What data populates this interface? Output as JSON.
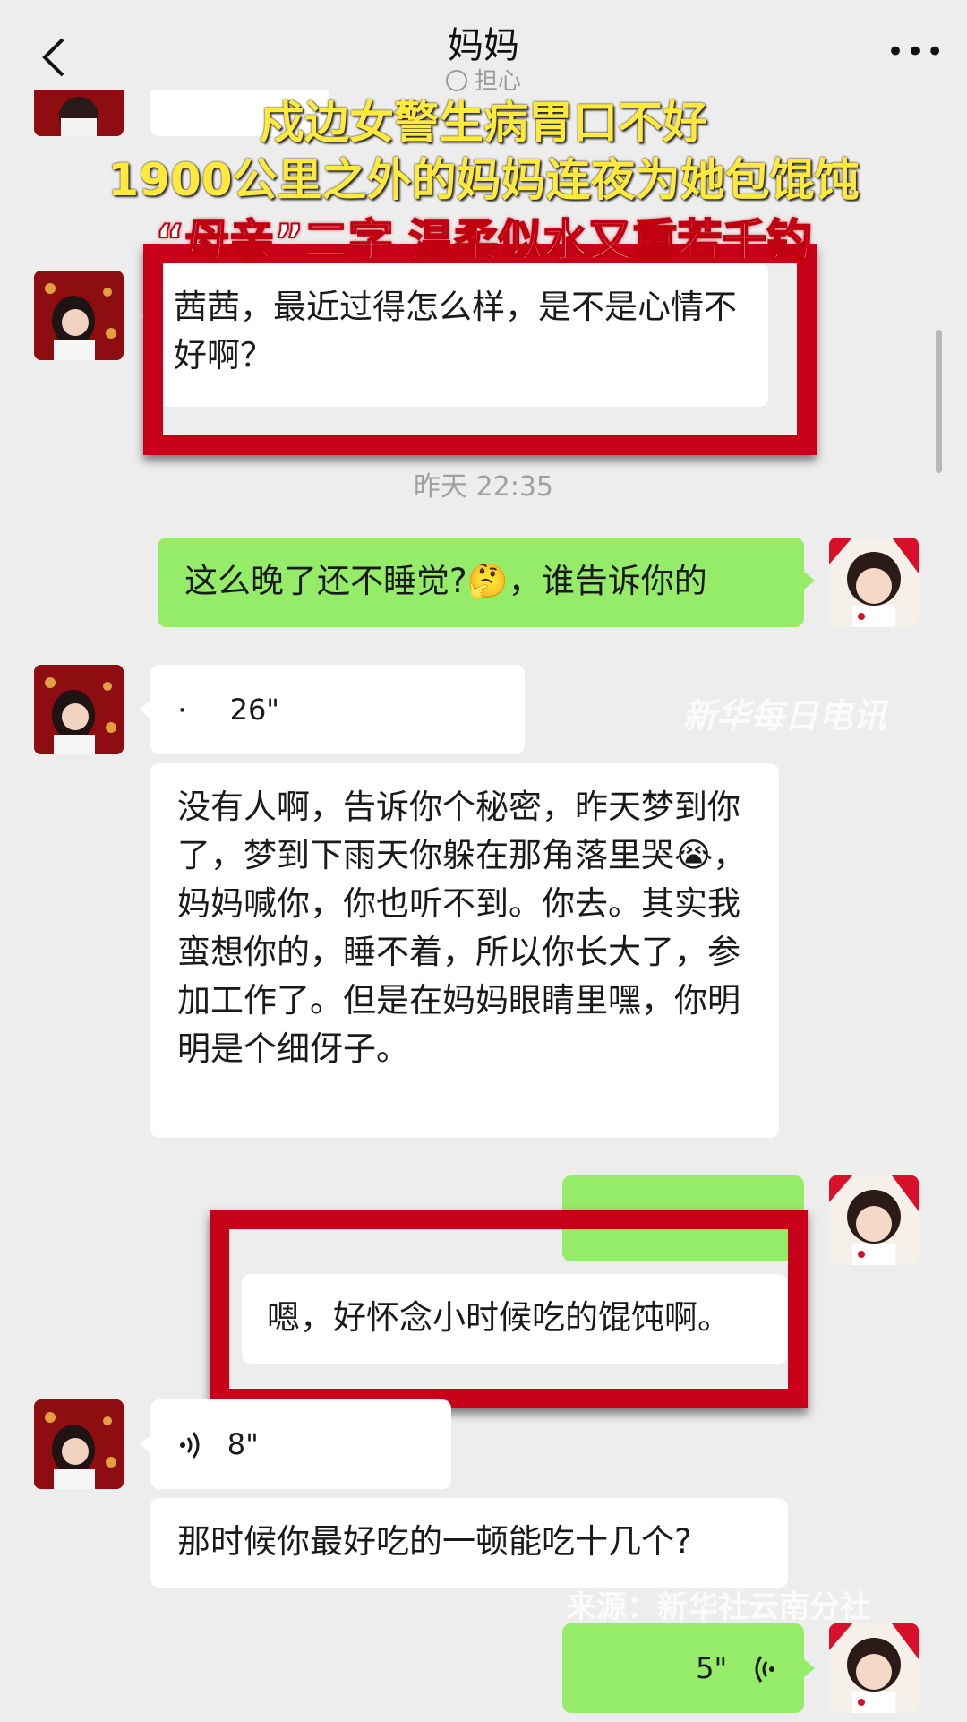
{
  "header": {
    "title": "妈妈",
    "status": "担心",
    "back_icon": "chevron-left-icon",
    "more_icon": "more-icon",
    "more_glyph": "•••"
  },
  "overlay": {
    "line1": "戍边女警生病胃口不好",
    "line2": "1900公里之外的妈妈连夜为她包馄饨",
    "line3": "“母亲”二字 温柔似水又重若千钧"
  },
  "messages": {
    "m1": "茜茜，最近过得怎么样，是不是心情不好啊？",
    "timestamp": "昨天 22:35",
    "m2": "这么晚了还不睡觉?🤔，谁告诉你的",
    "voice1_duration": "26\"",
    "m3": "没有人啊，告诉你个秘密，昨天梦到你了，梦到下雨天你躲在那角落里哭😭，妈妈喊你，你也听不到。你去。其实我蛮想你的，睡不着，所以你长大了，参加工作了。但是在妈妈眼睛里嘿，你明明是个细伢子。",
    "m4": "嗯，好怀念小时候吃的馄饨啊。",
    "voice2_duration": "8\"",
    "m5": "那时候你最好吃的一顿能吃十几个?",
    "voice3_duration": "5\""
  },
  "watermarks": {
    "logo": "新华每日电讯",
    "source": "来源：新华社云南分社"
  },
  "colors": {
    "background": "#ededed",
    "sent_bubble": "#95ec69",
    "received_bubble": "#ffffff",
    "highlight_box": "#c8001a",
    "overlay_yellow": "#ffe93a"
  }
}
